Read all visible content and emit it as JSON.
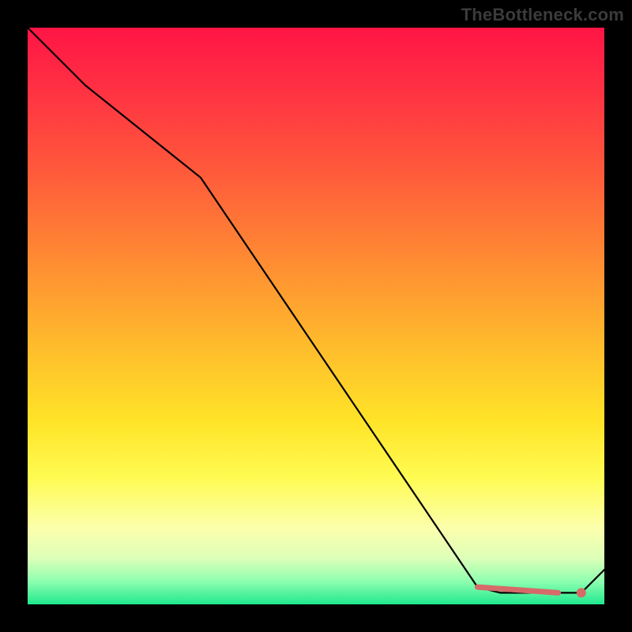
{
  "watermark": "TheBottleneck.com",
  "chart_data": {
    "type": "line",
    "title": "",
    "xlabel": "",
    "ylabel": "",
    "xlim": [
      0,
      100
    ],
    "ylim": [
      0,
      100
    ],
    "grid": false,
    "legend": false,
    "series": [
      {
        "name": "bottleneck-curve",
        "x": [
          0,
          10,
          25,
          30,
          78,
          82,
          92,
          96,
          100
        ],
        "y": [
          100,
          90,
          78,
          74,
          3,
          2,
          2,
          2,
          6
        ]
      }
    ],
    "highlight": {
      "segment": {
        "x0": 78,
        "y0": 3,
        "x1": 92,
        "y1": 2
      },
      "point": {
        "x": 96,
        "y": 2
      }
    },
    "colors": {
      "curve": "#000000",
      "highlight": "#d56a69",
      "gradient_top": "#ff1545",
      "gradient_mid": "#ffe327",
      "gradient_bottom": "#20e88e",
      "background": "#000000"
    }
  }
}
